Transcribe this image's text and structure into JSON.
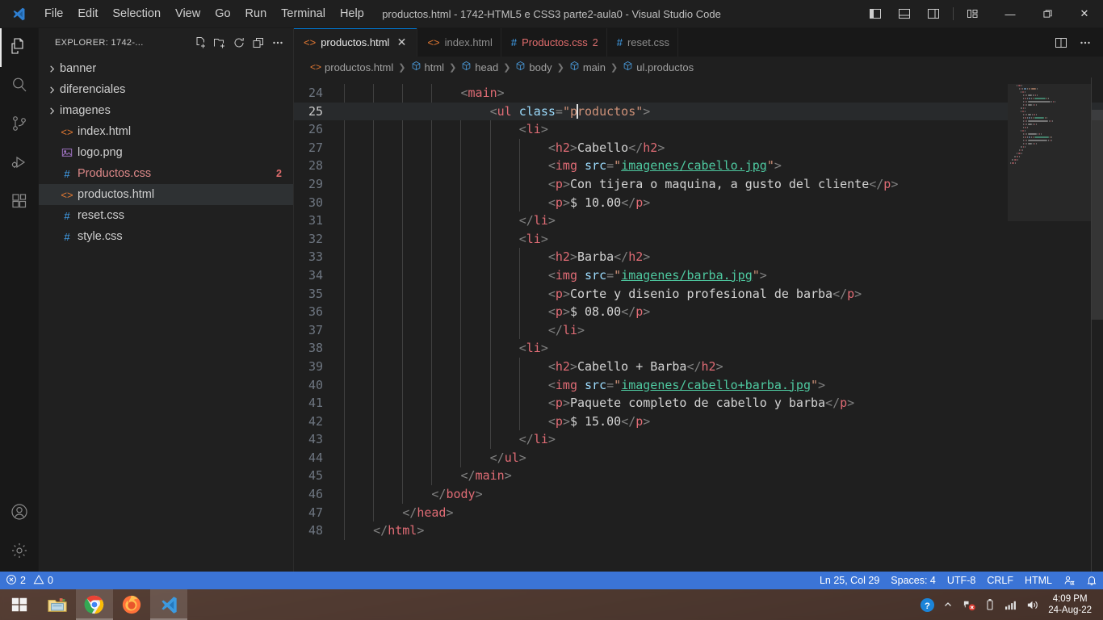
{
  "window": {
    "title": "productos.html - 1742-HTML5 e CSS3 parte2-aula0 - Visual Studio Code",
    "minimize_label": "—",
    "maximize_label": "❐",
    "close_label": "✕"
  },
  "menu": {
    "items": [
      {
        "label": "File"
      },
      {
        "label": "Edit"
      },
      {
        "label": "Selection"
      },
      {
        "label": "View"
      },
      {
        "label": "Go"
      },
      {
        "label": "Run"
      },
      {
        "label": "Terminal"
      },
      {
        "label": "Help"
      }
    ]
  },
  "layout_controls": [
    {
      "name": "toggle-primary-sidebar-icon"
    },
    {
      "name": "toggle-panel-icon"
    },
    {
      "name": "toggle-secondary-sidebar-icon"
    },
    {
      "name": "customize-layout-icon"
    }
  ],
  "activitybar": {
    "items": [
      {
        "name": "explorer",
        "icon": "files-icon",
        "active": true
      },
      {
        "name": "search",
        "icon": "search-icon",
        "active": false
      },
      {
        "name": "source-control",
        "icon": "source-control-icon",
        "active": false
      },
      {
        "name": "run-and-debug",
        "icon": "run-debug-icon",
        "active": false
      },
      {
        "name": "extensions",
        "icon": "extensions-icon",
        "active": false
      }
    ],
    "bottom": [
      {
        "name": "accounts",
        "icon": "account-icon"
      },
      {
        "name": "manage",
        "icon": "gear-icon"
      }
    ]
  },
  "sidebar": {
    "title": "EXPLORER: 1742-...",
    "actions": [
      {
        "name": "new-file-icon"
      },
      {
        "name": "new-folder-icon"
      },
      {
        "name": "refresh-icon"
      },
      {
        "name": "collapse-all-icon"
      },
      {
        "name": "views-and-more-actions-icon"
      }
    ],
    "tree": [
      {
        "label": "banner",
        "kind": "folder",
        "expanded": false,
        "selected": false,
        "badge": ""
      },
      {
        "label": "diferenciales",
        "kind": "folder",
        "expanded": false,
        "selected": false,
        "badge": ""
      },
      {
        "label": "imagenes",
        "kind": "folder",
        "expanded": false,
        "selected": false,
        "badge": ""
      },
      {
        "label": "index.html",
        "kind": "html",
        "expanded": null,
        "selected": false,
        "badge": ""
      },
      {
        "label": "logo.png",
        "kind": "image",
        "expanded": null,
        "selected": false,
        "badge": ""
      },
      {
        "label": "Productos.css",
        "kind": "css",
        "expanded": null,
        "selected": false,
        "badge": "2",
        "error": true
      },
      {
        "label": "productos.html",
        "kind": "html",
        "expanded": null,
        "selected": true,
        "badge": ""
      },
      {
        "label": "reset.css",
        "kind": "css",
        "expanded": null,
        "selected": false,
        "badge": ""
      },
      {
        "label": "style.css",
        "kind": "css",
        "expanded": null,
        "selected": false,
        "badge": ""
      }
    ]
  },
  "tabs": [
    {
      "label": "productos.html",
      "kind": "html",
      "active": true,
      "closable": true,
      "badge": "",
      "error": false
    },
    {
      "label": "index.html",
      "kind": "html",
      "active": false,
      "closable": false,
      "badge": "",
      "error": false
    },
    {
      "label": "Productos.css",
      "kind": "css",
      "active": false,
      "closable": false,
      "badge": "2",
      "error": true
    },
    {
      "label": "reset.css",
      "kind": "css",
      "active": false,
      "closable": false,
      "badge": "",
      "error": false
    }
  ],
  "tab_actions": [
    {
      "name": "split-editor-right-icon"
    },
    {
      "name": "more-actions-icon"
    }
  ],
  "breadcrumbs": [
    {
      "label": "productos.html",
      "icon": "html-file-icon"
    },
    {
      "label": "html",
      "icon": "symbol-field-icon"
    },
    {
      "label": "head",
      "icon": "symbol-field-icon"
    },
    {
      "label": "body",
      "icon": "symbol-field-icon"
    },
    {
      "label": "main",
      "icon": "symbol-field-icon"
    },
    {
      "label": "ul.productos",
      "icon": "symbol-field-icon"
    }
  ],
  "editor": {
    "first_line": 24,
    "current_line": 25,
    "lines": [
      {
        "n": 24,
        "indent": 4,
        "tokens": [
          {
            "t": "punc",
            "v": "<"
          },
          {
            "t": "tag",
            "v": "main"
          },
          {
            "t": "punc",
            "v": ">"
          }
        ]
      },
      {
        "n": 25,
        "indent": 5,
        "cursor_after": 1,
        "tokens": [
          {
            "t": "punc",
            "v": "<"
          },
          {
            "t": "tag",
            "v": "ul"
          },
          {
            "t": "txt",
            "v": " "
          },
          {
            "t": "attr",
            "v": "class"
          },
          {
            "t": "punc",
            "v": "="
          },
          {
            "t": "str",
            "v": "\"p"
          },
          {
            "t": "cursor",
            "v": ""
          },
          {
            "t": "str",
            "v": "roductos\""
          },
          {
            "t": "punc",
            "v": ">"
          }
        ]
      },
      {
        "n": 26,
        "indent": 6,
        "tokens": [
          {
            "t": "punc",
            "v": "<"
          },
          {
            "t": "tag",
            "v": "li"
          },
          {
            "t": "punc",
            "v": ">"
          }
        ]
      },
      {
        "n": 27,
        "indent": 7,
        "tokens": [
          {
            "t": "punc",
            "v": "<"
          },
          {
            "t": "tag",
            "v": "h2"
          },
          {
            "t": "punc",
            "v": ">"
          },
          {
            "t": "txt",
            "v": "Cabello"
          },
          {
            "t": "punc",
            "v": "</"
          },
          {
            "t": "tag",
            "v": "h2"
          },
          {
            "t": "punc",
            "v": ">"
          }
        ]
      },
      {
        "n": 28,
        "indent": 7,
        "tokens": [
          {
            "t": "punc",
            "v": "<"
          },
          {
            "t": "tag",
            "v": "img"
          },
          {
            "t": "txt",
            "v": " "
          },
          {
            "t": "attr",
            "v": "src"
          },
          {
            "t": "punc",
            "v": "="
          },
          {
            "t": "str",
            "v": "\""
          },
          {
            "t": "link",
            "v": "imagenes/cabello.jpg"
          },
          {
            "t": "str",
            "v": "\""
          },
          {
            "t": "punc",
            "v": ">"
          }
        ]
      },
      {
        "n": 29,
        "indent": 7,
        "tokens": [
          {
            "t": "punc",
            "v": "<"
          },
          {
            "t": "tag",
            "v": "p"
          },
          {
            "t": "punc",
            "v": ">"
          },
          {
            "t": "txt",
            "v": "Con tijera o maquina, a gusto del cliente"
          },
          {
            "t": "punc",
            "v": "</"
          },
          {
            "t": "tag",
            "v": "p"
          },
          {
            "t": "punc",
            "v": ">"
          }
        ]
      },
      {
        "n": 30,
        "indent": 7,
        "tokens": [
          {
            "t": "punc",
            "v": "<"
          },
          {
            "t": "tag",
            "v": "p"
          },
          {
            "t": "punc",
            "v": ">"
          },
          {
            "t": "txt",
            "v": "$ 10.00"
          },
          {
            "t": "punc",
            "v": "</"
          },
          {
            "t": "tag",
            "v": "p"
          },
          {
            "t": "punc",
            "v": ">"
          }
        ]
      },
      {
        "n": 31,
        "indent": 6,
        "tokens": [
          {
            "t": "punc",
            "v": "</"
          },
          {
            "t": "tag",
            "v": "li"
          },
          {
            "t": "punc",
            "v": ">"
          }
        ]
      },
      {
        "n": 32,
        "indent": 6,
        "tokens": [
          {
            "t": "punc",
            "v": "<"
          },
          {
            "t": "tag",
            "v": "li"
          },
          {
            "t": "punc",
            "v": ">"
          }
        ]
      },
      {
        "n": 33,
        "indent": 7,
        "tokens": [
          {
            "t": "punc",
            "v": "<"
          },
          {
            "t": "tag",
            "v": "h2"
          },
          {
            "t": "punc",
            "v": ">"
          },
          {
            "t": "txt",
            "v": "Barba"
          },
          {
            "t": "punc",
            "v": "</"
          },
          {
            "t": "tag",
            "v": "h2"
          },
          {
            "t": "punc",
            "v": ">"
          }
        ]
      },
      {
        "n": 34,
        "indent": 7,
        "tokens": [
          {
            "t": "punc",
            "v": "<"
          },
          {
            "t": "tag",
            "v": "img"
          },
          {
            "t": "txt",
            "v": " "
          },
          {
            "t": "attr",
            "v": "src"
          },
          {
            "t": "punc",
            "v": "="
          },
          {
            "t": "str",
            "v": "\""
          },
          {
            "t": "link",
            "v": "imagenes/barba.jpg"
          },
          {
            "t": "str",
            "v": "\""
          },
          {
            "t": "punc",
            "v": ">"
          }
        ]
      },
      {
        "n": 35,
        "indent": 7,
        "tokens": [
          {
            "t": "punc",
            "v": "<"
          },
          {
            "t": "tag",
            "v": "p"
          },
          {
            "t": "punc",
            "v": ">"
          },
          {
            "t": "txt",
            "v": "Corte y disenio profesional de barba"
          },
          {
            "t": "punc",
            "v": "</"
          },
          {
            "t": "tag",
            "v": "p"
          },
          {
            "t": "punc",
            "v": ">"
          }
        ]
      },
      {
        "n": 36,
        "indent": 7,
        "tokens": [
          {
            "t": "punc",
            "v": "<"
          },
          {
            "t": "tag",
            "v": "p"
          },
          {
            "t": "punc",
            "v": ">"
          },
          {
            "t": "txt",
            "v": "$ 08.00"
          },
          {
            "t": "punc",
            "v": "</"
          },
          {
            "t": "tag",
            "v": "p"
          },
          {
            "t": "punc",
            "v": ">"
          }
        ]
      },
      {
        "n": 37,
        "indent": 7,
        "tokens": [
          {
            "t": "punc",
            "v": "</"
          },
          {
            "t": "tag",
            "v": "li"
          },
          {
            "t": "punc",
            "v": ">"
          }
        ]
      },
      {
        "n": 38,
        "indent": 6,
        "tokens": [
          {
            "t": "punc",
            "v": "<"
          },
          {
            "t": "tag",
            "v": "li"
          },
          {
            "t": "punc",
            "v": ">"
          }
        ]
      },
      {
        "n": 39,
        "indent": 7,
        "tokens": [
          {
            "t": "punc",
            "v": "<"
          },
          {
            "t": "tag",
            "v": "h2"
          },
          {
            "t": "punc",
            "v": ">"
          },
          {
            "t": "txt",
            "v": "Cabello + Barba"
          },
          {
            "t": "punc",
            "v": "</"
          },
          {
            "t": "tag",
            "v": "h2"
          },
          {
            "t": "punc",
            "v": ">"
          }
        ]
      },
      {
        "n": 40,
        "indent": 7,
        "tokens": [
          {
            "t": "punc",
            "v": "<"
          },
          {
            "t": "tag",
            "v": "img"
          },
          {
            "t": "txt",
            "v": " "
          },
          {
            "t": "attr",
            "v": "src"
          },
          {
            "t": "punc",
            "v": "="
          },
          {
            "t": "str",
            "v": "\""
          },
          {
            "t": "link",
            "v": "imagenes/cabello+barba.jpg"
          },
          {
            "t": "str",
            "v": "\""
          },
          {
            "t": "punc",
            "v": ">"
          }
        ]
      },
      {
        "n": 41,
        "indent": 7,
        "tokens": [
          {
            "t": "punc",
            "v": "<"
          },
          {
            "t": "tag",
            "v": "p"
          },
          {
            "t": "punc",
            "v": ">"
          },
          {
            "t": "txt",
            "v": "Paquete completo de cabello y barba"
          },
          {
            "t": "punc",
            "v": "</"
          },
          {
            "t": "tag",
            "v": "p"
          },
          {
            "t": "punc",
            "v": ">"
          }
        ]
      },
      {
        "n": 42,
        "indent": 7,
        "tokens": [
          {
            "t": "punc",
            "v": "<"
          },
          {
            "t": "tag",
            "v": "p"
          },
          {
            "t": "punc",
            "v": ">"
          },
          {
            "t": "txt",
            "v": "$ 15.00"
          },
          {
            "t": "punc",
            "v": "</"
          },
          {
            "t": "tag",
            "v": "p"
          },
          {
            "t": "punc",
            "v": ">"
          }
        ]
      },
      {
        "n": 43,
        "indent": 6,
        "tokens": [
          {
            "t": "punc",
            "v": "</"
          },
          {
            "t": "tag",
            "v": "li"
          },
          {
            "t": "punc",
            "v": ">"
          }
        ]
      },
      {
        "n": 44,
        "indent": 5,
        "tokens": [
          {
            "t": "punc",
            "v": "</"
          },
          {
            "t": "tag",
            "v": "ul"
          },
          {
            "t": "punc",
            "v": ">"
          }
        ]
      },
      {
        "n": 45,
        "indent": 4,
        "tokens": [
          {
            "t": "punc",
            "v": "</"
          },
          {
            "t": "tag",
            "v": "main"
          },
          {
            "t": "punc",
            "v": ">"
          }
        ]
      },
      {
        "n": 46,
        "indent": 3,
        "tokens": [
          {
            "t": "punc",
            "v": "</"
          },
          {
            "t": "tag",
            "v": "body"
          },
          {
            "t": "punc",
            "v": ">"
          }
        ]
      },
      {
        "n": 47,
        "indent": 2,
        "tokens": [
          {
            "t": "punc",
            "v": "</"
          },
          {
            "t": "tag",
            "v": "head"
          },
          {
            "t": "punc",
            "v": ">"
          }
        ]
      },
      {
        "n": 48,
        "indent": 1,
        "tokens": [
          {
            "t": "punc",
            "v": "</"
          },
          {
            "t": "tag",
            "v": "html"
          },
          {
            "t": "punc",
            "v": ">"
          }
        ]
      }
    ]
  },
  "statusbar": {
    "errors": "2",
    "warnings": "0",
    "position": "Ln 25, Col 29",
    "indentation": "Spaces: 4",
    "encoding": "UTF-8",
    "eol": "CRLF",
    "language": "HTML",
    "right_icons": [
      {
        "name": "feedback-icon"
      },
      {
        "name": "notifications-bell-icon"
      }
    ]
  },
  "taskbar": {
    "start": {
      "name": "windows-start-icon"
    },
    "apps": [
      {
        "name": "file-explorer-icon",
        "running": false
      },
      {
        "name": "google-chrome-icon",
        "running": true
      },
      {
        "name": "firefox-icon",
        "running": false
      },
      {
        "name": "vscode-icon",
        "running": true
      }
    ],
    "tray": [
      {
        "name": "help-icon"
      },
      {
        "name": "show-hidden-icons-icon"
      },
      {
        "name": "network-error-icon"
      },
      {
        "name": "battery-icon"
      },
      {
        "name": "signal-icon"
      },
      {
        "name": "volume-icon"
      }
    ],
    "time": "4:09 PM",
    "date": "24-Aug-22"
  },
  "colors": {
    "accent": "#0078d4",
    "statusbar": "#3b74d6",
    "error": "#e06c6c",
    "tag": "#e06c75",
    "attr": "#9cdcfe",
    "string": "#ce9178",
    "link": "#4ec9a0"
  }
}
